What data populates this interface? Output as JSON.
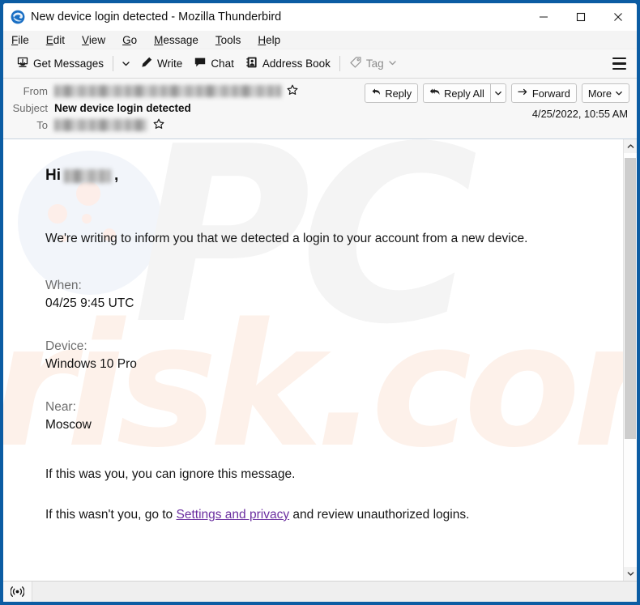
{
  "window": {
    "title": "New device login detected - Mozilla Thunderbird",
    "app_icon": "thunderbird-icon",
    "controls": {
      "minimize": "minimize-icon",
      "maximize": "maximize-icon",
      "close": "close-icon"
    },
    "frame_color": "#0b5ca3"
  },
  "menubar": {
    "items": [
      {
        "label": "File",
        "accesskey": "F"
      },
      {
        "label": "Edit",
        "accesskey": "E"
      },
      {
        "label": "View",
        "accesskey": "V"
      },
      {
        "label": "Go",
        "accesskey": "G"
      },
      {
        "label": "Message",
        "accesskey": "M"
      },
      {
        "label": "Tools",
        "accesskey": "T"
      },
      {
        "label": "Help",
        "accesskey": "H"
      }
    ]
  },
  "toolbar": {
    "get_messages": "Get Messages",
    "write": "Write",
    "chat": "Chat",
    "address_book": "Address Book",
    "tag": "Tag",
    "tag_disabled": true,
    "app_menu": "hamburger-menu-icon"
  },
  "message_header": {
    "from_label": "From",
    "from_value": "",
    "from_redacted": true,
    "subject_label": "Subject",
    "subject_value": "New device login detected",
    "to_label": "To",
    "to_value": "",
    "to_redacted": true,
    "date": "4/25/2022, 10:55 AM",
    "actions": {
      "reply": "Reply",
      "reply_all": "Reply All",
      "forward": "Forward",
      "more": "More"
    }
  },
  "message_body": {
    "greeting_prefix": "Hi",
    "greeting_name_redacted": true,
    "greeting_suffix": ",",
    "intro": "We're writing to inform you that we detected a login to your account from a new device.",
    "details": [
      {
        "label": "When:",
        "value": "04/25 9:45 UTC"
      },
      {
        "label": "Device:",
        "value": "Windows 10 Pro"
      },
      {
        "label": "Near:",
        "value": "Moscow"
      }
    ],
    "tail_1": "If this was you, you can ignore this message.",
    "tail_2_before": "If this wasn't you, go to ",
    "tail_2_link": "Settings and privacy",
    "tail_2_after": " and review unauthorized logins.",
    "link_color": "#6b2fa0",
    "watermark_primary": "PC",
    "watermark_secondary": "risk.com"
  },
  "statusbar": {
    "icon": "broadcast-icon",
    "text": ""
  }
}
